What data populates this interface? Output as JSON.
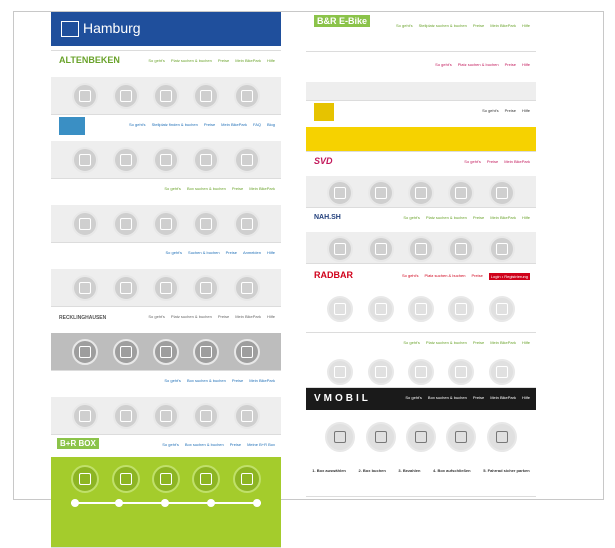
{
  "hamburg": {
    "title": "Hamburg"
  },
  "left_tiles": [
    {
      "logo": "ALTENBEKEN",
      "nav": [
        "So geht's",
        "Platz suchen & buchen",
        "Preise",
        "Mein BikePark",
        "Hilfe"
      ]
    },
    {
      "logo": "",
      "nav": [
        "So geht's",
        "Stellplatz finden & buchen",
        "Preise",
        "Mein BikePark",
        "FAQ",
        "Blog"
      ]
    },
    {
      "logo": "",
      "nav": [
        "So geht's",
        "Box suchen & buchen",
        "Preise",
        "Mein BikePark"
      ]
    },
    {
      "logo": "",
      "nav": [
        "So geht's",
        "Suchen & buchen",
        "Preise",
        "Anmelden",
        "Hilfe"
      ]
    },
    {
      "logo": "RECKLINGHAUSEN",
      "nav": [
        "So geht's",
        "Platz suchen & buchen",
        "Preise",
        "Mein BikePark",
        "Hilfe"
      ]
    },
    {
      "logo": "",
      "nav": [
        "So geht's",
        "Box suchen & buchen",
        "Preise",
        "Mein BikePark"
      ]
    }
  ],
  "br_box": {
    "logo": "B+R BOX",
    "nav": [
      "So geht's",
      "Box suchen & buchen",
      "Preise",
      "Meine B+R Box"
    ]
  },
  "right_tiles": [
    {
      "logo": "B&R E-Bike",
      "nav": [
        "So geht's",
        "Stellplatz suchen & buchen",
        "Preise",
        "Mein BikePark",
        "Hilfe"
      ]
    },
    {
      "logo": "",
      "nav": [
        "So geht's",
        "Platz suchen & buchen",
        "Preise",
        "Hilfe"
      ]
    },
    {
      "logo": "",
      "nav": [
        "So geht's",
        "Preise",
        "Hilfe"
      ]
    },
    {
      "logo": "SVD",
      "nav": [
        "So geht's",
        "Preise",
        "Mein BikePark"
      ]
    },
    {
      "logo": "NAH.SH",
      "nav": [
        "So geht's",
        "Platz suchen & buchen",
        "Preise",
        "Mein BikePark",
        "Hilfe"
      ]
    },
    {
      "logo": "RADBAR",
      "nav": [
        "So geht's",
        "Platz suchen & buchen",
        "Preise",
        "Login • Registrierung"
      ]
    },
    {
      "logo": "",
      "nav": [
        "So geht's",
        "Platz suchen & buchen",
        "Preise",
        "Mein BikePark",
        "Hilfe"
      ]
    }
  ],
  "vmobil": {
    "logo": "VMOBIL",
    "nav": [
      "So geht's",
      "Box suchen & buchen",
      "Preise",
      "Mein BikePark",
      "Hilfe"
    ],
    "steps": [
      "1. Box auswählen",
      "2. Box buchen",
      "3. Bezahlen",
      "4. Box aufschließen",
      "5. Fahrrad sicher parken"
    ]
  },
  "colors": {
    "hamburg_blue": "#1f4f9c",
    "green": "#a4cc2c",
    "yellow": "#f6d200",
    "dark": "#1a1a1a",
    "red": "#d0021b"
  }
}
